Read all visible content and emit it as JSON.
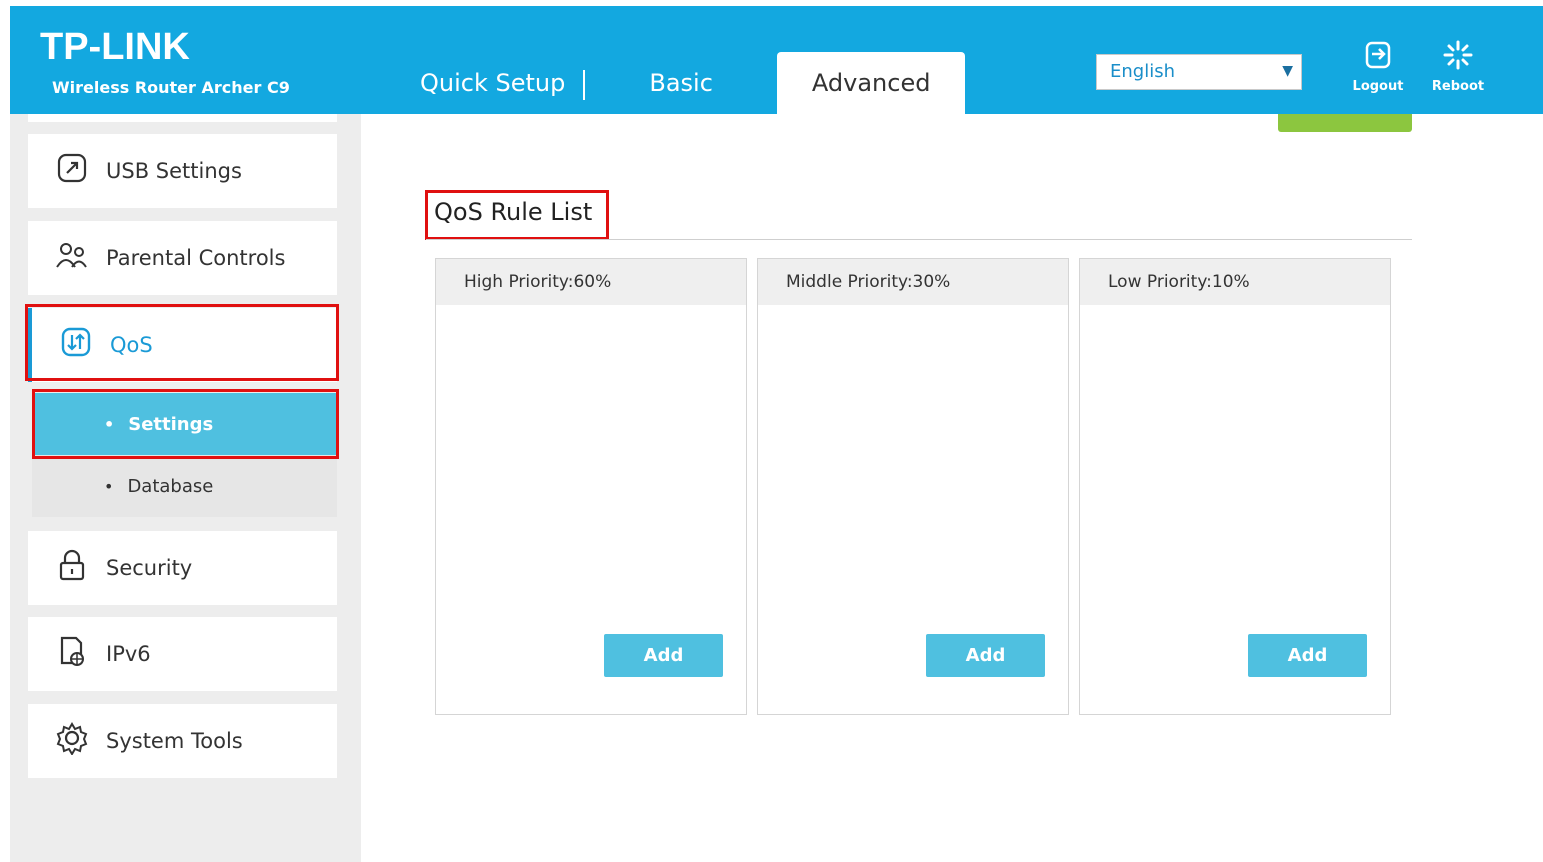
{
  "header": {
    "logo": "TP-LINK",
    "model": "Wireless Router Archer C9",
    "tabs": [
      {
        "label": "Quick Setup"
      },
      {
        "label": "Basic"
      },
      {
        "label": "Advanced"
      }
    ],
    "language": "English",
    "logout_label": "Logout",
    "reboot_label": "Reboot",
    "accent_color": "#13a8e0"
  },
  "sidebar": {
    "items": [
      {
        "label": "USB Settings",
        "icon": "usb-icon"
      },
      {
        "label": "Parental Controls",
        "icon": "parental-icon"
      },
      {
        "label": "QoS",
        "icon": "qos-icon"
      },
      {
        "label": "Security",
        "icon": "lock-icon"
      },
      {
        "label": "IPv6",
        "icon": "ipv6-icon"
      },
      {
        "label": "System Tools",
        "icon": "gear-icon"
      }
    ],
    "qos_sub": [
      {
        "label": "Settings"
      },
      {
        "label": "Database"
      }
    ]
  },
  "main": {
    "title": "QoS Rule List",
    "panels": [
      {
        "label": "High Priority:60%",
        "add_label": "Add"
      },
      {
        "label": "Middle Priority:30%",
        "add_label": "Add"
      },
      {
        "label": "Low Priority:10%",
        "add_label": "Add"
      }
    ]
  }
}
